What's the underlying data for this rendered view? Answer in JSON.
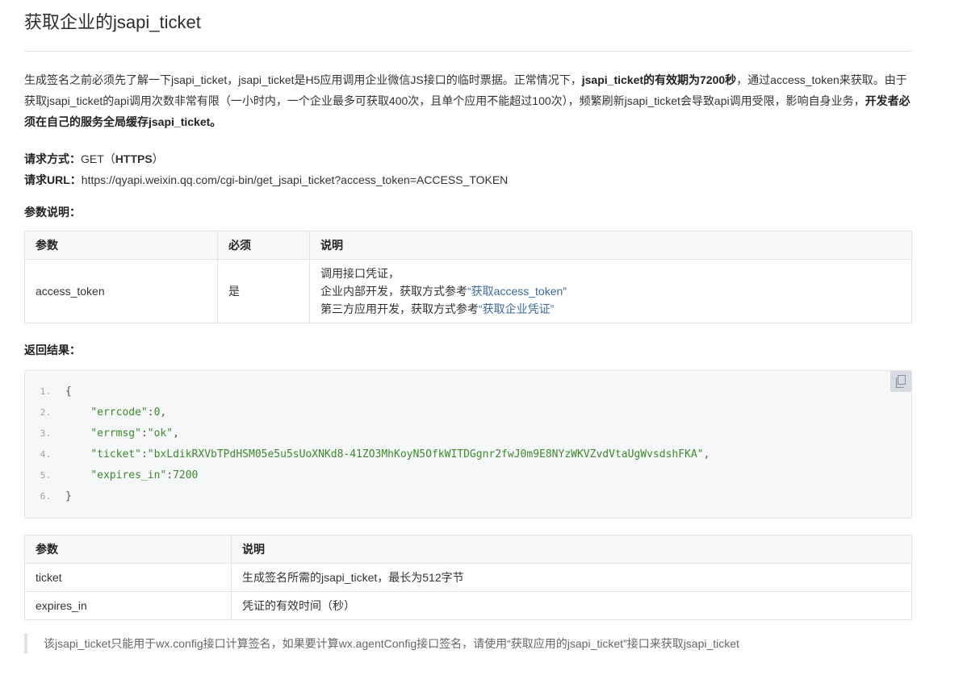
{
  "page": {
    "title": "获取企业的jsapi_ticket"
  },
  "intro": {
    "p1": "生成签名之前必须先了解一下jsapi_ticket，jsapi_ticket是H5应用调用企业微信JS接口的临时票据。正常情况下，",
    "b1": "jsapi_ticket的有效期为7200秒",
    "p2": "，通过access_token来获取。由于获取jsapi_ticket的api调用次数非常有限（一小时内，一个企业最多可获取400次，且单个应用不能超过100次），频繁刷新jsapi_ticket会导致api调用受限，影响自身业务，",
    "b2": "开发者必须在自己的服务全局缓存jsapi_ticket。"
  },
  "request": {
    "method_label": "请求方式：",
    "method_value_prefix": "GET（",
    "method_value_bold": "HTTPS",
    "method_value_suffix": "）",
    "url_label": "请求URL：",
    "url_value": "https://qyapi.weixin.qq.com/cgi-bin/get_jsapi_ticket?access_token=ACCESS_TOKEN"
  },
  "params_section": {
    "label": "参数说明：",
    "headers": [
      "参数",
      "必须",
      "说明"
    ],
    "row": {
      "name": "access_token",
      "required": "是",
      "desc_line1": "调用接口凭证，",
      "desc_line2_prefix": "企业内部开发，获取方式参考",
      "desc_line2_link": "“获取access_token”",
      "desc_line3_prefix": "第三方应用开发，获取方式参考",
      "desc_line3_link": "“获取企业凭证”"
    }
  },
  "result_section": {
    "label": "返回结果：",
    "code": {
      "line_numbers": [
        "1.",
        "2.",
        "3.",
        "4.",
        "5.",
        "6."
      ],
      "open_brace": "{",
      "close_brace": "}",
      "errcode_key": "\"errcode\"",
      "errcode_val": "0",
      "errmsg_key": "\"errmsg\"",
      "errmsg_val": "\"ok\"",
      "ticket_key": "\"ticket\"",
      "ticket_val": "\"bxLdikRXVbTPdHSM05e5u5sUoXNKd8-41ZO3MhKoyN5OfkWITDGgnr2fwJ0m9E8NYzWKVZvdVtaUgWvsdshFKA\"",
      "expires_key": "\"expires_in\"",
      "expires_val": "7200"
    }
  },
  "fields_table": {
    "headers": [
      "参数",
      "说明"
    ],
    "rows": [
      {
        "name": "ticket",
        "desc": "生成签名所需的jsapi_ticket，最长为512字节"
      },
      {
        "name": "expires_in",
        "desc": "凭证的有效时间（秒）"
      }
    ]
  },
  "note": {
    "text": "该jsapi_ticket只能用于wx.config接口计算签名，如果要计算wx.agentConfig接口签名，请使用“获取应用的jsapi_ticket”接口来获取jsapi_ticket"
  },
  "colors": {
    "link": "#3a6aa0",
    "code_string": "#3c8a2a",
    "code_background": "#f6f7f9"
  },
  "icons": {
    "copy": "copy-icon"
  }
}
